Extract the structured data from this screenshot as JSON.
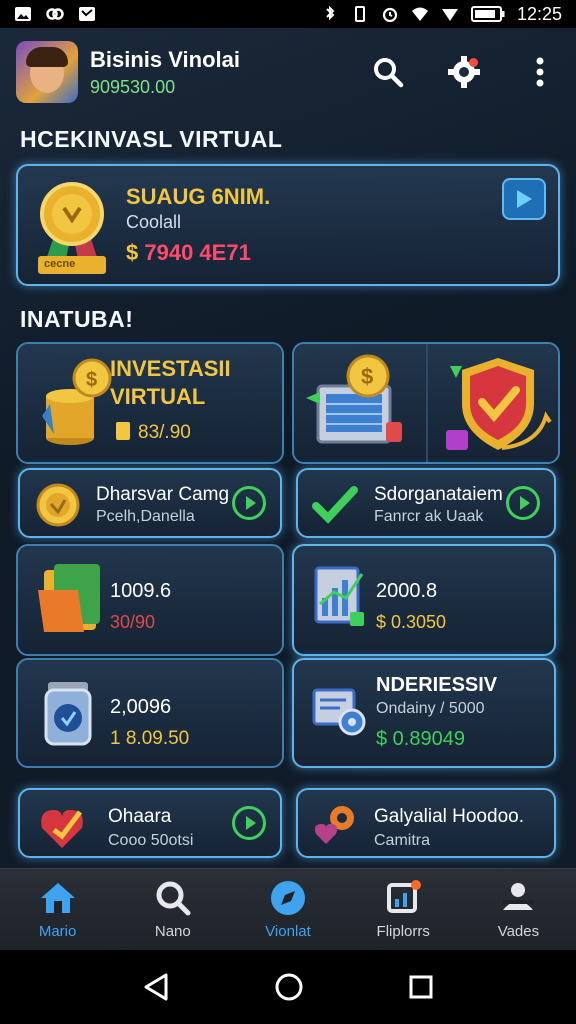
{
  "status_bar": {
    "time": "12:25"
  },
  "header": {
    "user_name": "Bisinis Vinolai",
    "user_balance": "909530.00"
  },
  "sections": {
    "top_title": "HCEKINVASL VIRTUAL",
    "mid_title": "INATUBA!"
  },
  "feature": {
    "title": "SUAUG 6NIM.",
    "subtitle": "Coolall",
    "amount_currency": "$",
    "amount": "7940 4E71",
    "medal_label": "cecne"
  },
  "invest_card": {
    "title_line1": "INVESTASII",
    "title_line2": "VIRTUAL",
    "amount": "83/.90"
  },
  "list_cards": [
    {
      "title": "Dharsvar Camg",
      "subtitle": "Pcelh,Danella"
    },
    {
      "title": "Sdorganataiem",
      "subtitle": "Fanrcr ak Uaak"
    }
  ],
  "stat_cards": [
    {
      "value": "1009.6",
      "amount": "30/90"
    },
    {
      "value": "2000.8",
      "amount": "$ 0.3050"
    },
    {
      "value": "2,0096",
      "amount": "1 8.09.50"
    },
    {
      "title": "NDERIESSIV",
      "subtitle": "Ondainy / 5000",
      "amount": "$ 0.89049"
    }
  ],
  "bottom_cards": [
    {
      "title": "Ohaara",
      "subtitle": "Cooo 50otsi"
    },
    {
      "title": "Galyalial Hoodoo.",
      "subtitle": "Camitra"
    }
  ],
  "bottom_nav": [
    {
      "label": "Mario"
    },
    {
      "label": "Nano"
    },
    {
      "label": "Vionlat"
    },
    {
      "label": "Fliplorrs"
    },
    {
      "label": "Vades"
    }
  ],
  "colors": {
    "accent_blue": "#3fa3ef",
    "gold": "#f2c640",
    "green": "#3fcf5a",
    "red_amount": "#ff4a6a"
  }
}
